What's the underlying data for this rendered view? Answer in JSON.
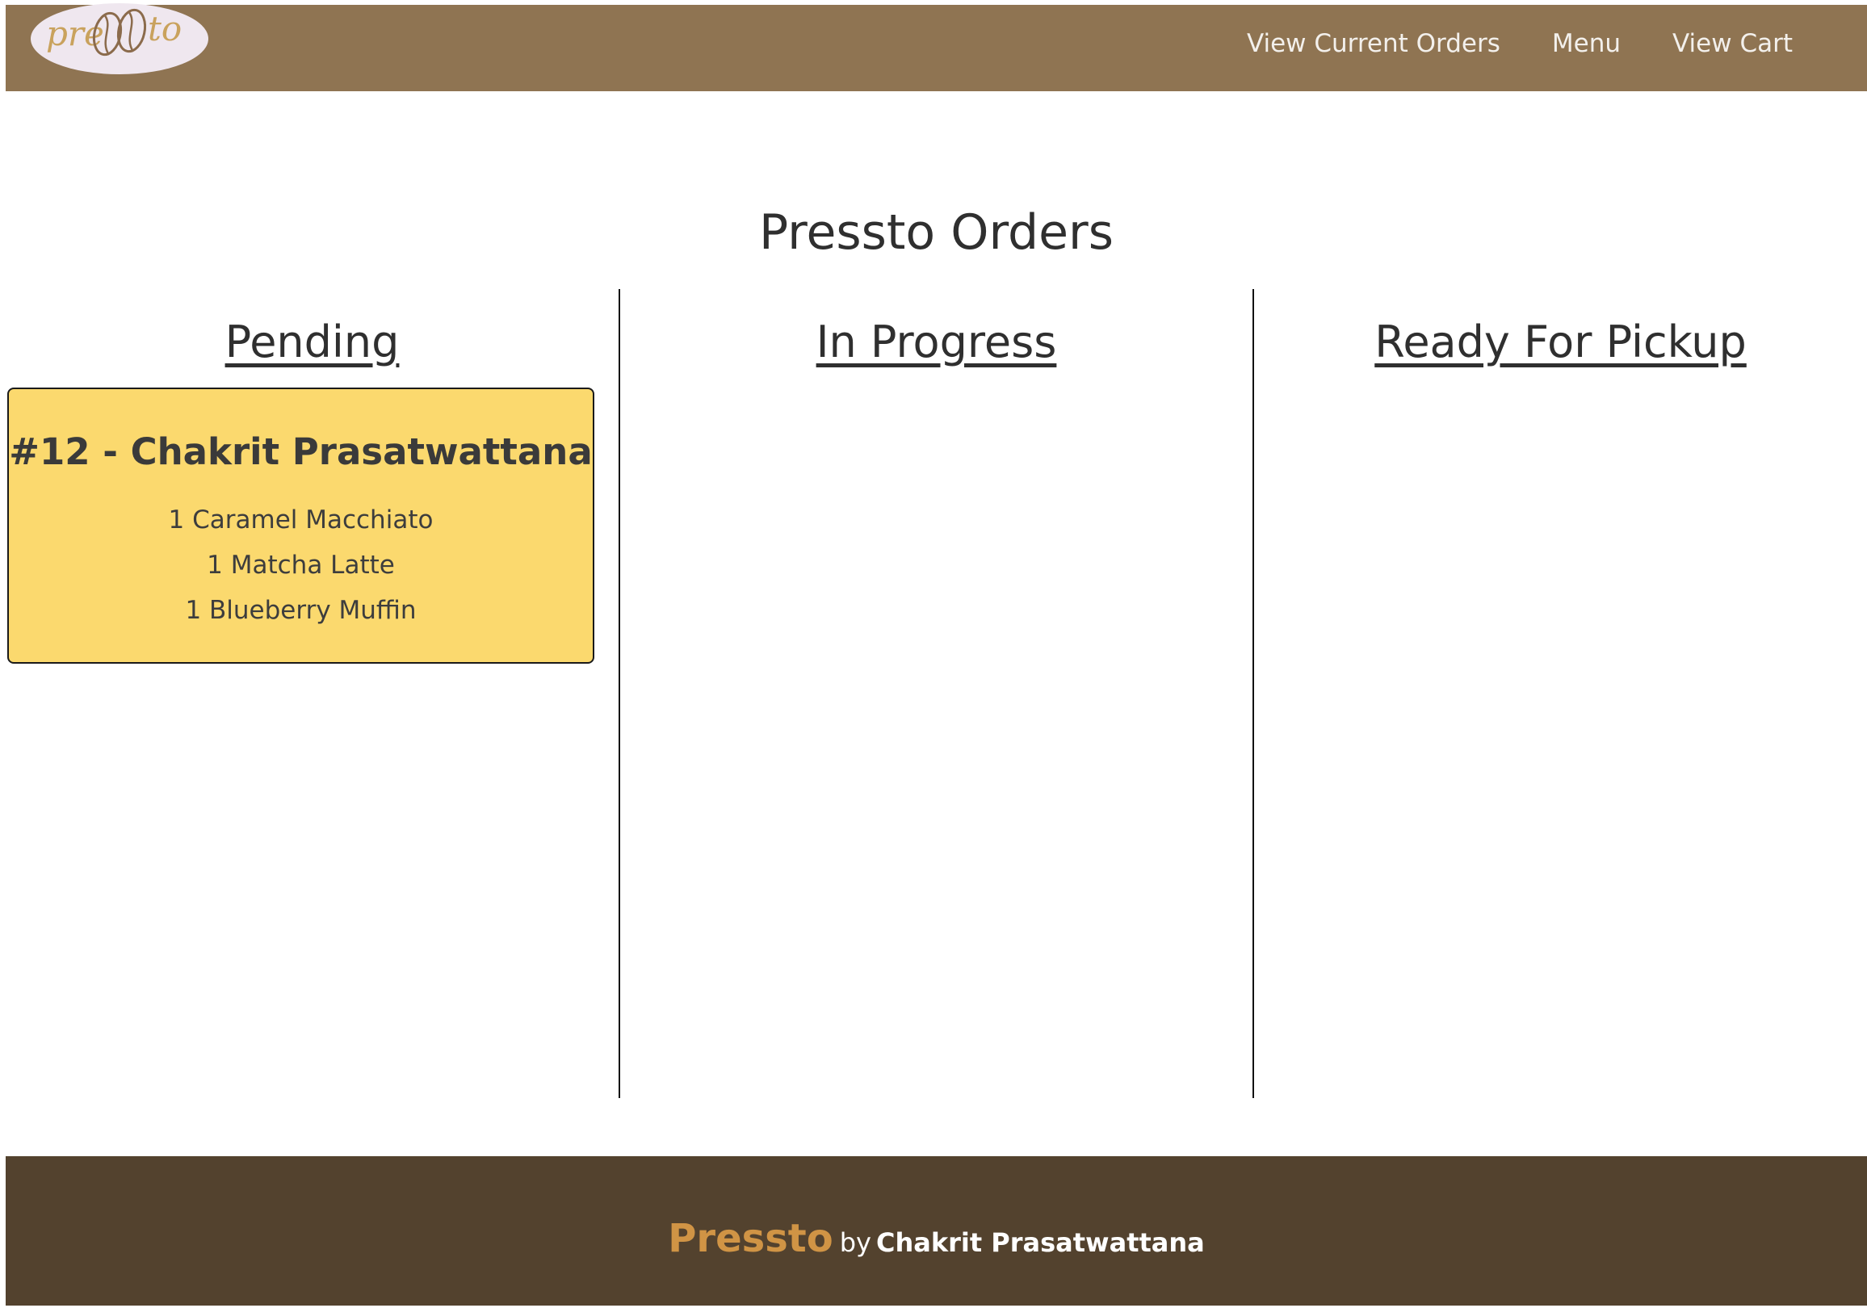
{
  "navbar": {
    "logo_text_left": "pre",
    "logo_text_right": "to",
    "links": [
      {
        "label": "View Current Orders"
      },
      {
        "label": "Menu"
      },
      {
        "label": "View Cart"
      }
    ]
  },
  "main": {
    "title": "Pressto Orders",
    "columns": [
      {
        "heading": "Pending",
        "orders": [
          {
            "title": "#12 - Chakrit Prasatwattana",
            "items": [
              "1 Caramel Macchiato",
              "1 Matcha Latte",
              "1 Blueberry Muffin"
            ]
          }
        ]
      },
      {
        "heading": "In Progress",
        "orders": []
      },
      {
        "heading": "Ready For Pickup",
        "orders": []
      }
    ]
  },
  "footer": {
    "brand": "Pressto",
    "by": "by",
    "author": "Chakrit Prasatwattana"
  },
  "colors": {
    "navbar": "#8f7452",
    "card": "#fbd96e",
    "footer": "#53422e",
    "brand": "#d09445"
  }
}
